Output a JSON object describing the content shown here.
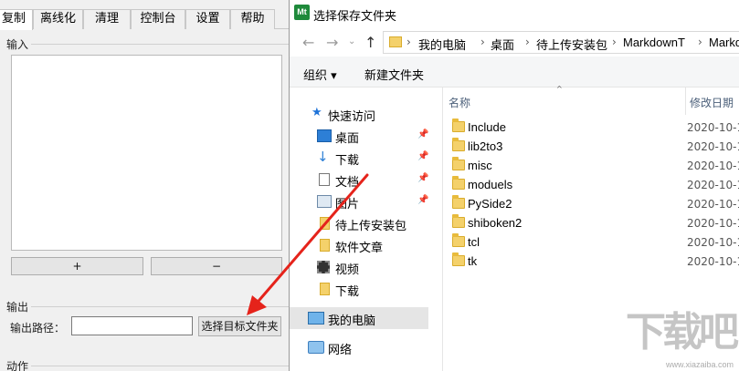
{
  "app": {
    "tabs": [
      "复制",
      "离线化",
      "清理",
      "控制台",
      "设置",
      "帮助"
    ],
    "input_section": "输入",
    "add_button": "+",
    "remove_button": "−",
    "output_section": "输出",
    "output_path_label": "输出路径：",
    "output_path_value": "",
    "choose_folder_button": "选择目标文件夹",
    "action_section": "动作"
  },
  "dialog": {
    "logo_text": "Mt",
    "title": "选择保存文件夹",
    "breadcrumbs": [
      "我的电脑",
      "桌面",
      "待上传安装包",
      "MarkdownT",
      "Markdo"
    ],
    "toolbar": {
      "organize": "组织 ▾",
      "new_folder": "新建文件夹"
    },
    "nav": {
      "quick_access": "快速访问",
      "items": [
        {
          "label": "桌面",
          "icon": "desktop-icon",
          "pinned": true
        },
        {
          "label": "下载",
          "icon": "download-icon",
          "pinned": true
        },
        {
          "label": "文档",
          "icon": "document-icon",
          "pinned": true
        },
        {
          "label": "图片",
          "icon": "pictures-icon",
          "pinned": true
        },
        {
          "label": "待上传安装包",
          "icon": "folder-icon",
          "pinned": false
        },
        {
          "label": "软件文章",
          "icon": "folder-icon",
          "pinned": false
        },
        {
          "label": "视频",
          "icon": "video-icon",
          "pinned": false
        },
        {
          "label": "下载",
          "icon": "folder-icon",
          "pinned": false
        }
      ],
      "this_pc": "我的电脑",
      "network": "网络"
    },
    "columns": {
      "name": "名称",
      "modified": "修改日期"
    },
    "files": [
      {
        "name": "Include",
        "date": "2020-10-1"
      },
      {
        "name": "lib2to3",
        "date": "2020-10-1"
      },
      {
        "name": "misc",
        "date": "2020-10-1"
      },
      {
        "name": "moduels",
        "date": "2020-10-1"
      },
      {
        "name": "PySide2",
        "date": "2020-10-1"
      },
      {
        "name": "shiboken2",
        "date": "2020-10-1"
      },
      {
        "name": "tcl",
        "date": "2020-10-1"
      },
      {
        "name": "tk",
        "date": "2020-10-1"
      }
    ]
  },
  "watermark": {
    "text": "下载吧",
    "url": "www.xiazaiba.com"
  },
  "colors": {
    "arrow": "#e5231b",
    "folder": "#f4d16b",
    "selected": "#e5e5e5"
  }
}
